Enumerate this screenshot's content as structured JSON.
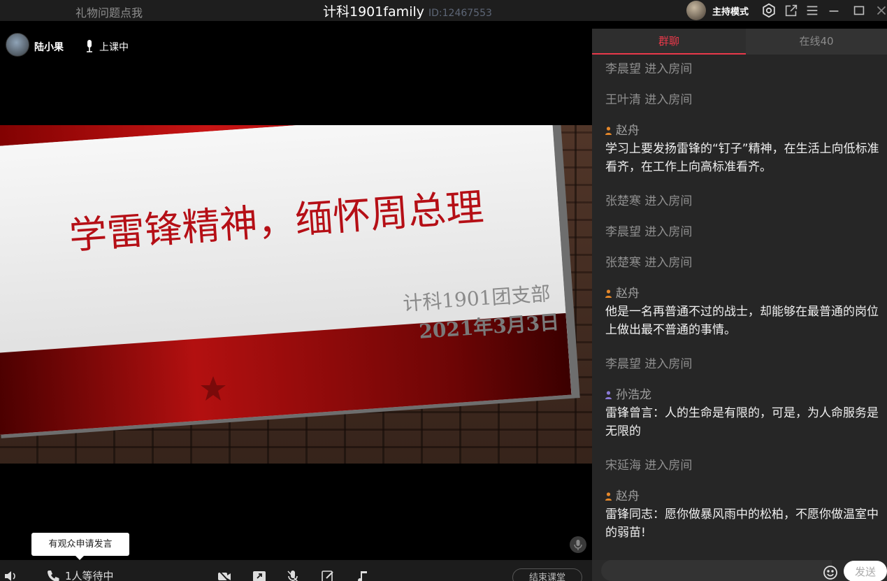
{
  "titlebar": {
    "gift_link": "礼物问题点我",
    "room_name": "计科1901family",
    "room_id": "ID:12467553",
    "host_mode": "主持模式"
  },
  "stage": {
    "presenter_name": "陆小果",
    "status": "上课中",
    "slide": {
      "title": "学雷锋精神，缅怀周总理",
      "subtitle": "计科1901团支部",
      "date": "2021年3月3日"
    },
    "tooltip": "有观众申请发言"
  },
  "bottombar": {
    "waiting": "1人等待中",
    "end_button": "结束课堂"
  },
  "chat": {
    "tabs": {
      "group": "群聊",
      "online": "在线40"
    },
    "messages": [
      {
        "type": "system",
        "text": "李晨望 进入房间"
      },
      {
        "type": "system",
        "text": "王叶清 进入房间"
      },
      {
        "type": "user",
        "sender": "赵舟",
        "badge_color": "#e6882a",
        "text": "学习上要发扬雷锋的“钉子”精神，在生活上向低标准看齐，在工作上向高标准看齐。"
      },
      {
        "type": "system",
        "text": "张楚寒 进入房间"
      },
      {
        "type": "system",
        "text": "李晨望 进入房间"
      },
      {
        "type": "system",
        "text": "张楚寒 进入房间"
      },
      {
        "type": "user",
        "sender": "赵舟",
        "badge_color": "#e6882a",
        "text": "他是一名再普通不过的战士，却能够在最普通的岗位上做出最不普通的事情。"
      },
      {
        "type": "system",
        "text": "李晨望 进入房间"
      },
      {
        "type": "user",
        "sender": "孙浩龙",
        "badge_color": "#8a7ad6",
        "text": "雷锋曾言：人的生命是有限的，可是，为人命服务是无限的"
      },
      {
        "type": "system",
        "text": "宋延海 进入房间"
      },
      {
        "type": "user",
        "sender": "赵舟",
        "badge_color": "#e6882a",
        "text": "雷锋同志：愿你做暴风雨中的松柏，不愿你做温室中的弱苗!"
      }
    ],
    "send_button": "发送"
  }
}
